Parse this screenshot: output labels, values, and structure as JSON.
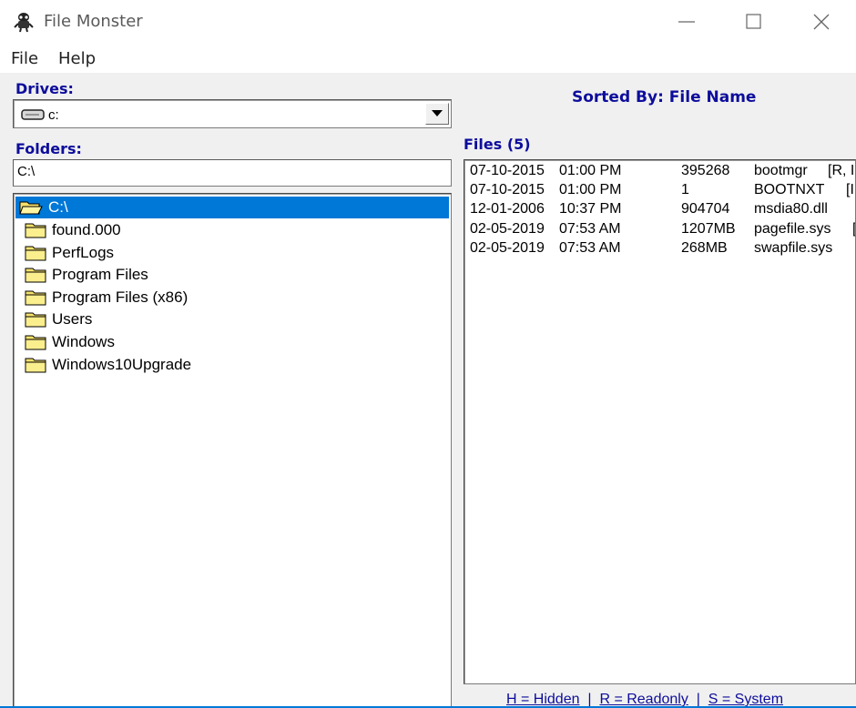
{
  "window": {
    "title": "File Monster"
  },
  "menu": {
    "file": "File",
    "help": "Help"
  },
  "drives": {
    "label": "Drives:",
    "selected": "c:"
  },
  "sort": {
    "text": "Sorted By: File Name"
  },
  "folders": {
    "label": "Folders:",
    "path": "C:\\",
    "tree": [
      {
        "name": "C:\\",
        "selected": true
      },
      {
        "name": "found.000"
      },
      {
        "name": "PerfLogs"
      },
      {
        "name": "Program Files"
      },
      {
        "name": "Program Files (x86)"
      },
      {
        "name": "Users"
      },
      {
        "name": "Windows"
      },
      {
        "name": "Windows10Upgrade"
      }
    ]
  },
  "files": {
    "label": "Files (5)",
    "rows": [
      {
        "date": "07-10-2015",
        "time": "01:00 PM",
        "size": "395268",
        "name": "bootmgr",
        "attr": "[R, I"
      },
      {
        "date": "07-10-2015",
        "time": "01:00 PM",
        "size": "1",
        "name": "BOOTNXT",
        "attr": "[I"
      },
      {
        "date": "12-01-2006",
        "time": "10:37 PM",
        "size": "904704",
        "name": "msdia80.dll",
        "attr": ""
      },
      {
        "date": "02-05-2019",
        "time": "07:53 AM",
        "size": "1207MB",
        "name": "pagefile.sys",
        "attr": "["
      },
      {
        "date": "02-05-2019",
        "time": "07:53 AM",
        "size": "268MB",
        "name": "swapfile.sys",
        "attr": ""
      }
    ]
  },
  "legend": {
    "hidden": "H = Hidden",
    "readonly": "R = Readonly",
    "system": "S = System",
    "sep": "|"
  }
}
